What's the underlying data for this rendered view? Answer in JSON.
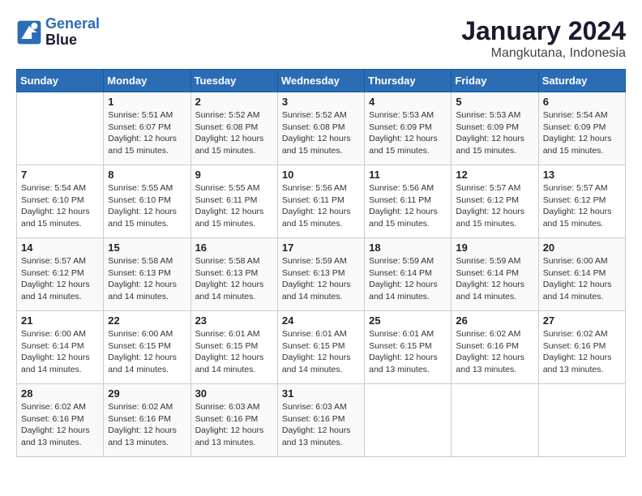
{
  "logo": {
    "line1": "General",
    "line2": "Blue"
  },
  "title": "January 2024",
  "subtitle": "Mangkutana, Indonesia",
  "days_of_week": [
    "Sunday",
    "Monday",
    "Tuesday",
    "Wednesday",
    "Thursday",
    "Friday",
    "Saturday"
  ],
  "weeks": [
    [
      {
        "day": "",
        "sunrise": "",
        "sunset": "",
        "daylight": ""
      },
      {
        "day": "1",
        "sunrise": "Sunrise: 5:51 AM",
        "sunset": "Sunset: 6:07 PM",
        "daylight": "Daylight: 12 hours and 15 minutes."
      },
      {
        "day": "2",
        "sunrise": "Sunrise: 5:52 AM",
        "sunset": "Sunset: 6:08 PM",
        "daylight": "Daylight: 12 hours and 15 minutes."
      },
      {
        "day": "3",
        "sunrise": "Sunrise: 5:52 AM",
        "sunset": "Sunset: 6:08 PM",
        "daylight": "Daylight: 12 hours and 15 minutes."
      },
      {
        "day": "4",
        "sunrise": "Sunrise: 5:53 AM",
        "sunset": "Sunset: 6:09 PM",
        "daylight": "Daylight: 12 hours and 15 minutes."
      },
      {
        "day": "5",
        "sunrise": "Sunrise: 5:53 AM",
        "sunset": "Sunset: 6:09 PM",
        "daylight": "Daylight: 12 hours and 15 minutes."
      },
      {
        "day": "6",
        "sunrise": "Sunrise: 5:54 AM",
        "sunset": "Sunset: 6:09 PM",
        "daylight": "Daylight: 12 hours and 15 minutes."
      }
    ],
    [
      {
        "day": "7",
        "sunrise": "Sunrise: 5:54 AM",
        "sunset": "Sunset: 6:10 PM",
        "daylight": "Daylight: 12 hours and 15 minutes."
      },
      {
        "day": "8",
        "sunrise": "Sunrise: 5:55 AM",
        "sunset": "Sunset: 6:10 PM",
        "daylight": "Daylight: 12 hours and 15 minutes."
      },
      {
        "day": "9",
        "sunrise": "Sunrise: 5:55 AM",
        "sunset": "Sunset: 6:11 PM",
        "daylight": "Daylight: 12 hours and 15 minutes."
      },
      {
        "day": "10",
        "sunrise": "Sunrise: 5:56 AM",
        "sunset": "Sunset: 6:11 PM",
        "daylight": "Daylight: 12 hours and 15 minutes."
      },
      {
        "day": "11",
        "sunrise": "Sunrise: 5:56 AM",
        "sunset": "Sunset: 6:11 PM",
        "daylight": "Daylight: 12 hours and 15 minutes."
      },
      {
        "day": "12",
        "sunrise": "Sunrise: 5:57 AM",
        "sunset": "Sunset: 6:12 PM",
        "daylight": "Daylight: 12 hours and 15 minutes."
      },
      {
        "day": "13",
        "sunrise": "Sunrise: 5:57 AM",
        "sunset": "Sunset: 6:12 PM",
        "daylight": "Daylight: 12 hours and 15 minutes."
      }
    ],
    [
      {
        "day": "14",
        "sunrise": "Sunrise: 5:57 AM",
        "sunset": "Sunset: 6:12 PM",
        "daylight": "Daylight: 12 hours and 14 minutes."
      },
      {
        "day": "15",
        "sunrise": "Sunrise: 5:58 AM",
        "sunset": "Sunset: 6:13 PM",
        "daylight": "Daylight: 12 hours and 14 minutes."
      },
      {
        "day": "16",
        "sunrise": "Sunrise: 5:58 AM",
        "sunset": "Sunset: 6:13 PM",
        "daylight": "Daylight: 12 hours and 14 minutes."
      },
      {
        "day": "17",
        "sunrise": "Sunrise: 5:59 AM",
        "sunset": "Sunset: 6:13 PM",
        "daylight": "Daylight: 12 hours and 14 minutes."
      },
      {
        "day": "18",
        "sunrise": "Sunrise: 5:59 AM",
        "sunset": "Sunset: 6:14 PM",
        "daylight": "Daylight: 12 hours and 14 minutes."
      },
      {
        "day": "19",
        "sunrise": "Sunrise: 5:59 AM",
        "sunset": "Sunset: 6:14 PM",
        "daylight": "Daylight: 12 hours and 14 minutes."
      },
      {
        "day": "20",
        "sunrise": "Sunrise: 6:00 AM",
        "sunset": "Sunset: 6:14 PM",
        "daylight": "Daylight: 12 hours and 14 minutes."
      }
    ],
    [
      {
        "day": "21",
        "sunrise": "Sunrise: 6:00 AM",
        "sunset": "Sunset: 6:14 PM",
        "daylight": "Daylight: 12 hours and 14 minutes."
      },
      {
        "day": "22",
        "sunrise": "Sunrise: 6:00 AM",
        "sunset": "Sunset: 6:15 PM",
        "daylight": "Daylight: 12 hours and 14 minutes."
      },
      {
        "day": "23",
        "sunrise": "Sunrise: 6:01 AM",
        "sunset": "Sunset: 6:15 PM",
        "daylight": "Daylight: 12 hours and 14 minutes."
      },
      {
        "day": "24",
        "sunrise": "Sunrise: 6:01 AM",
        "sunset": "Sunset: 6:15 PM",
        "daylight": "Daylight: 12 hours and 14 minutes."
      },
      {
        "day": "25",
        "sunrise": "Sunrise: 6:01 AM",
        "sunset": "Sunset: 6:15 PM",
        "daylight": "Daylight: 12 hours and 13 minutes."
      },
      {
        "day": "26",
        "sunrise": "Sunrise: 6:02 AM",
        "sunset": "Sunset: 6:16 PM",
        "daylight": "Daylight: 12 hours and 13 minutes."
      },
      {
        "day": "27",
        "sunrise": "Sunrise: 6:02 AM",
        "sunset": "Sunset: 6:16 PM",
        "daylight": "Daylight: 12 hours and 13 minutes."
      }
    ],
    [
      {
        "day": "28",
        "sunrise": "Sunrise: 6:02 AM",
        "sunset": "Sunset: 6:16 PM",
        "daylight": "Daylight: 12 hours and 13 minutes."
      },
      {
        "day": "29",
        "sunrise": "Sunrise: 6:02 AM",
        "sunset": "Sunset: 6:16 PM",
        "daylight": "Daylight: 12 hours and 13 minutes."
      },
      {
        "day": "30",
        "sunrise": "Sunrise: 6:03 AM",
        "sunset": "Sunset: 6:16 PM",
        "daylight": "Daylight: 12 hours and 13 minutes."
      },
      {
        "day": "31",
        "sunrise": "Sunrise: 6:03 AM",
        "sunset": "Sunset: 6:16 PM",
        "daylight": "Daylight: 12 hours and 13 minutes."
      },
      {
        "day": "",
        "sunrise": "",
        "sunset": "",
        "daylight": ""
      },
      {
        "day": "",
        "sunrise": "",
        "sunset": "",
        "daylight": ""
      },
      {
        "day": "",
        "sunrise": "",
        "sunset": "",
        "daylight": ""
      }
    ]
  ]
}
